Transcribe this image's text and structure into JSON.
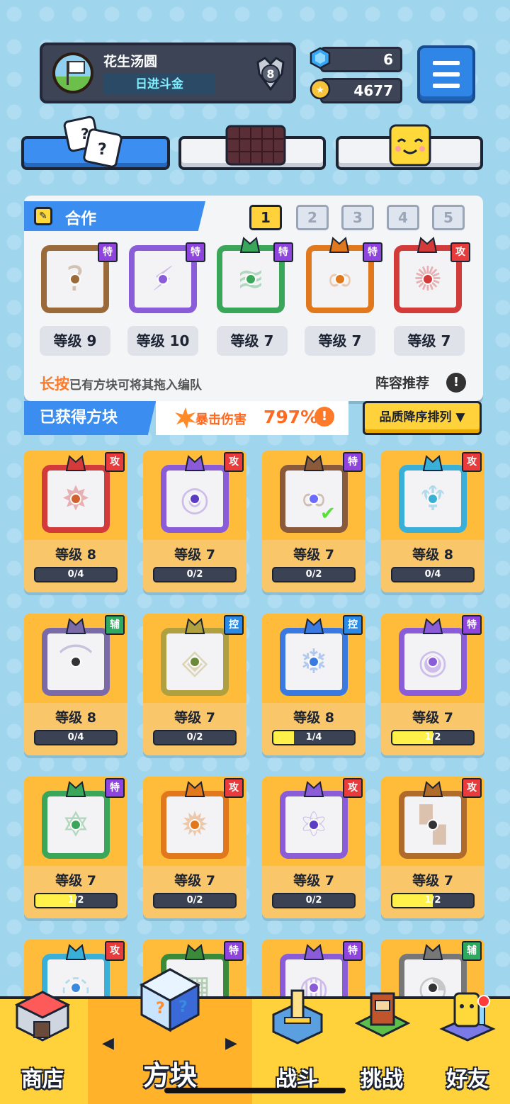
{
  "profile": {
    "name": "花生汤圆",
    "title": "日进斗金",
    "rank_badge": "8"
  },
  "currency": {
    "gems": "6",
    "coins": "4677"
  },
  "menu": {
    "icon": "hamburger-menu-icon"
  },
  "top_tabs": [
    {
      "icon": "dice-icon",
      "active": true
    },
    {
      "icon": "chocolate-board-icon",
      "active": false
    },
    {
      "icon": "smiley-cube-icon",
      "active": false
    }
  ],
  "team": {
    "mode_label": "合作",
    "slots": [
      "1",
      "2",
      "3",
      "4",
      "5"
    ],
    "active_slot": "1",
    "blocks": [
      {
        "level": "等级 9",
        "tag": "特",
        "color": "#9a6a3a"
      },
      {
        "level": "等级 10",
        "tag": "特",
        "color": "#8a5cd8"
      },
      {
        "level": "等级 7",
        "tag": "特",
        "color": "#3aa65a"
      },
      {
        "level": "等级 7",
        "tag": "特",
        "color": "#e2781c"
      },
      {
        "level": "等级 7",
        "tag": "攻",
        "color": "#d33a3a"
      }
    ],
    "hint_highlight": "长按",
    "hint_rest": "已有方块可将其拖入编队",
    "recommend_label": "阵容推荐"
  },
  "acquired": {
    "header": "已获得方块",
    "crit_label": "暴击伤害",
    "crit_value": "797%",
    "sort_label": "品质降序排列 ▼"
  },
  "cards": [
    {
      "level": "等级 8",
      "progress": "0/4",
      "fill": 0,
      "tag": "攻",
      "tagtype": "t-atk",
      "frame": "#d33a3a",
      "dot": "#d2612e",
      "glyph": "✸"
    },
    {
      "level": "等级 7",
      "progress": "0/2",
      "fill": 0,
      "tag": "攻",
      "tagtype": "t-atk",
      "frame": "#8a5cd8",
      "dot": "#5b3cc4",
      "glyph": "◎"
    },
    {
      "level": "等级 7",
      "progress": "0/2",
      "fill": 0,
      "tag": "特",
      "tagtype": "t-spec",
      "frame": "#8a5a3a",
      "dot": "#6b6bff",
      "glyph": "∞",
      "check": true
    },
    {
      "level": "等级 8",
      "progress": "0/4",
      "fill": 0,
      "tag": "攻",
      "tagtype": "t-atk",
      "frame": "#3ab0d8",
      "dot": "#3ab0d8",
      "glyph": "♆"
    },
    {
      "level": "等级 8",
      "progress": "0/4",
      "fill": 0,
      "tag": "辅",
      "tagtype": "t-sup",
      "frame": "#7a6aa8",
      "dot": "#333333",
      "glyph": "⌒"
    },
    {
      "level": "等级 7",
      "progress": "0/2",
      "fill": 0,
      "tag": "控",
      "tagtype": "t-ctl",
      "frame": "#b0a040",
      "dot": "#6a8a3a",
      "glyph": "◈"
    },
    {
      "level": "等级 8",
      "progress": "1/4",
      "fill": 0.25,
      "tag": "控",
      "tagtype": "t-ctl",
      "frame": "#3a7ae0",
      "dot": "#3a7ae0",
      "glyph": "❄"
    },
    {
      "level": "等级 7",
      "progress": "1/2",
      "fill": 0.5,
      "tag": "特",
      "tagtype": "t-spec",
      "frame": "#8a5cd8",
      "dot": "#8a5cd8",
      "glyph": "◉"
    },
    {
      "level": "等级 7",
      "progress": "1/2",
      "fill": 0.5,
      "tag": "特",
      "tagtype": "t-spec",
      "frame": "#3aa65a",
      "dot": "#3aa65a",
      "glyph": "✡"
    },
    {
      "level": "等级 7",
      "progress": "0/2",
      "fill": 0,
      "tag": "攻",
      "tagtype": "t-atk",
      "frame": "#e2781c",
      "dot": "#e2781c",
      "glyph": "✹"
    },
    {
      "level": "等级 7",
      "progress": "0/2",
      "fill": 0,
      "tag": "攻",
      "tagtype": "t-atk",
      "frame": "#8a5cd8",
      "dot": "#5b3cc4",
      "glyph": "⚛"
    },
    {
      "level": "等级 7",
      "progress": "1/2",
      "fill": 0.5,
      "tag": "攻",
      "tagtype": "t-atk",
      "frame": "#b06a2a",
      "dot": "#333333",
      "glyph": "▚"
    },
    {
      "level": "",
      "progress": "",
      "fill": 0,
      "tag": "攻",
      "tagtype": "t-atk",
      "frame": "#3ab0d8",
      "dot": "#3a8ae0",
      "glyph": "◌"
    },
    {
      "level": "",
      "progress": "",
      "fill": 0,
      "tag": "特",
      "tagtype": "t-spec",
      "frame": "#3a8a3a",
      "dot": "#3a8a3a",
      "glyph": "▦"
    },
    {
      "level": "",
      "progress": "",
      "fill": 0,
      "tag": "特",
      "tagtype": "t-spec",
      "frame": "#8a5cd8",
      "dot": "#8a5cd8",
      "glyph": "◍"
    },
    {
      "level": "",
      "progress": "",
      "fill": 0,
      "tag": "辅",
      "tagtype": "t-sup",
      "frame": "#777777",
      "dot": "#333333",
      "glyph": "◔"
    }
  ],
  "nav": {
    "items": [
      {
        "label": "商店",
        "icon": "shop-icon"
      },
      {
        "label": "方块",
        "icon": "cube-icon",
        "active": true
      },
      {
        "label": "战斗",
        "icon": "battle-icon"
      },
      {
        "label": "挑战",
        "icon": "challenge-icon"
      },
      {
        "label": "好友",
        "icon": "friends-icon"
      }
    ],
    "prev_arrow": "◀",
    "next_arrow": "▶"
  },
  "colors": {
    "accent": "#3b8ef0",
    "gold": "#ffd23c",
    "card": "#ffbb3a",
    "crit": "#ff6a20"
  }
}
